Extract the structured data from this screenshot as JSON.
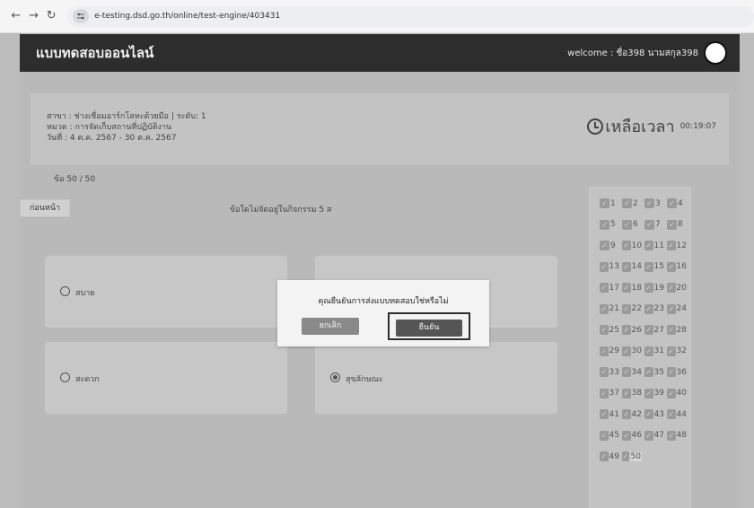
{
  "browser": {
    "back": "←",
    "forward": "→",
    "reload": "↻",
    "url": "e-testing.dsd.go.th/online/test-engine/403431"
  },
  "header": {
    "title": "แบบทดสอบออนไลน์",
    "welcome": "welcome : ชื่อ398 นามสกุล398"
  },
  "info": {
    "line1": "สาขา : ช่างเชื่อมอาร์กโลหะด้วยมือ | ระดับ: 1",
    "line2": "หมวด : การจัดเก็บสถานที่ปฏิบัติงาน",
    "line3": "วันที่ : 4 ต.ค. 2567 - 30 ต.ค. 2567"
  },
  "timer": {
    "label": "เหลือเวลา",
    "value": "00:19:07"
  },
  "question": {
    "counter": "ข้อ 50 / 50",
    "prev_label": "ก่อนหน้า",
    "text": "ข้อใดไม่จัดอยู่ในกิจกรรม 5 ส",
    "choices": [
      {
        "label": "สบาย",
        "selected": false
      },
      {
        "label": "",
        "selected": false
      },
      {
        "label": "สะดวก",
        "selected": false
      },
      {
        "label": "สุขลักษณะ",
        "selected": true
      }
    ]
  },
  "nav_grid": {
    "items": [
      "1",
      "2",
      "3",
      "4",
      "5",
      "6",
      "7",
      "8",
      "9",
      "10",
      "11",
      "12",
      "13",
      "14",
      "15",
      "16",
      "17",
      "18",
      "19",
      "20",
      "21",
      "22",
      "23",
      "24",
      "25",
      "26",
      "27",
      "28",
      "29",
      "30",
      "31",
      "32",
      "33",
      "34",
      "35",
      "36",
      "37",
      "38",
      "39",
      "40",
      "41",
      "42",
      "43",
      "44",
      "45",
      "46",
      "47",
      "48",
      "49",
      "50"
    ],
    "current": "50"
  },
  "modal": {
    "message": "คุณยืนยันการส่งแบบทดสอบใช่หรือไม่",
    "cancel_label": "ยกเลิก",
    "confirm_label": "ยืนยัน"
  }
}
